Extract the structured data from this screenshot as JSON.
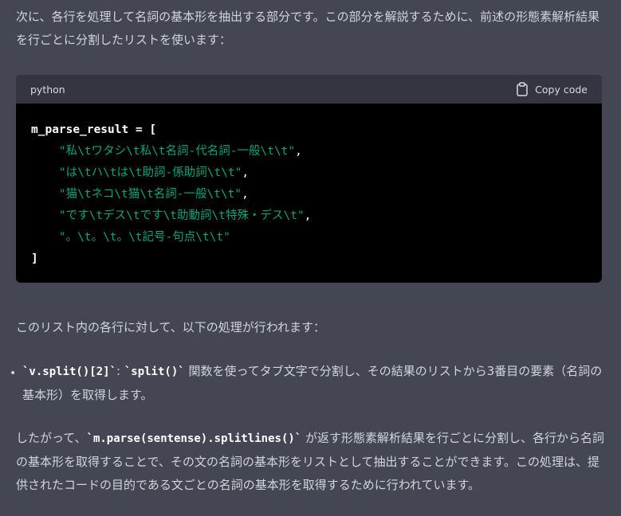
{
  "intro_text": "次に、各行を処理して名詞の基本形を抽出する部分です。この部分を解説するために、前述の形態素解析結果を行ごとに分割したリストを使います：",
  "code_block": {
    "language": "python",
    "copy_label": "Copy code",
    "lines": [
      {
        "plain": "m_parse_result = ["
      },
      {
        "indent": "    ",
        "string": "\"私\\tワタシ\\t私\\t名詞-代名詞-一般\\t\\t\"",
        "suffix": ","
      },
      {
        "indent": "    ",
        "string": "\"は\\tハ\\tは\\t助詞-係助詞\\t\\t\"",
        "suffix": ","
      },
      {
        "indent": "    ",
        "string": "\"猫\\tネコ\\t猫\\t名詞-一般\\t\\t\"",
        "suffix": ","
      },
      {
        "indent": "    ",
        "string": "\"です\\tデス\\tです\\t助動詞\\t特殊・デス\\t\"",
        "suffix": ","
      },
      {
        "indent": "    ",
        "string": "\"。\\t。\\t。\\t記号-句点\\t\\t\"",
        "suffix": ""
      },
      {
        "plain": "]"
      }
    ]
  },
  "para2": "このリスト内の各行に対して、以下の処理が行われます：",
  "bullet": {
    "code1": "`v.split()[2]`",
    "sep": ": ",
    "code2": "`split()`",
    "text": " 関数を使ってタブ文字で分割し、その結果のリストから3番目の要素（名詞の基本形）を取得します。"
  },
  "para3": {
    "pre": "したがって、",
    "code": "`m.parse(sentense).splitlines()`",
    "post": " が返す形態素解析結果を行ごとに分割し、各行から名詞の基本形を取得することで、その文の名詞の基本形をリストとして抽出することができます。この処理は、提供されたコードの目的である文ごとの名詞の基本形を取得するために行われています。"
  },
  "colors": {
    "background": "#444654",
    "code_bg": "#000000",
    "code_header_bg": "#343541",
    "string": "#00a67d",
    "text": "#d1d5db"
  }
}
